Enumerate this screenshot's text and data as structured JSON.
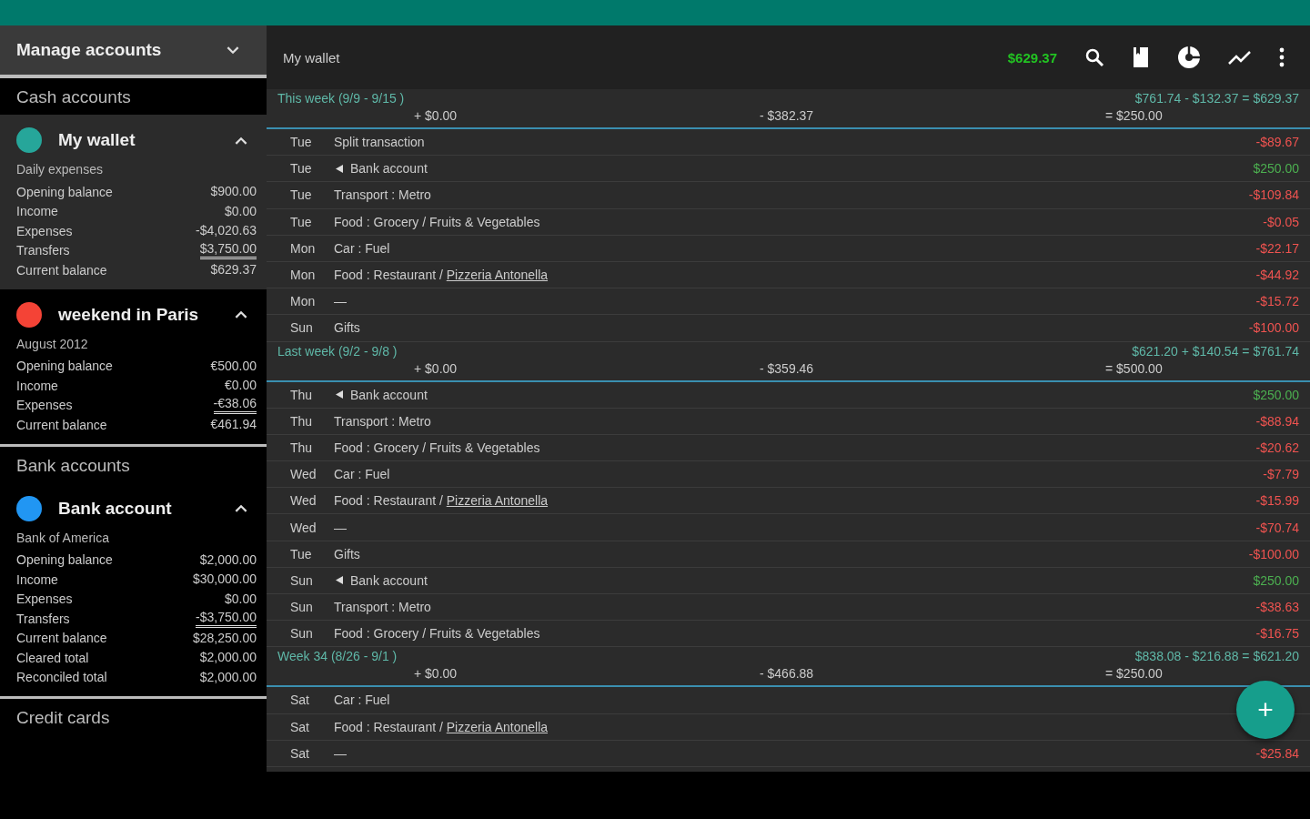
{
  "sidebar": {
    "title": "Manage accounts",
    "groups": [
      {
        "label": "Cash accounts",
        "accounts": [
          {
            "name": "My wallet",
            "color": "#26a69a",
            "expanded": true,
            "selected": true,
            "description": "Daily expenses",
            "lines": [
              {
                "label": "Opening balance",
                "value": "$900.00",
                "rule": false
              },
              {
                "label": "Income",
                "value": "$0.00",
                "rule": false
              },
              {
                "label": "Expenses",
                "value": "-$4,020.63",
                "rule": false
              },
              {
                "label": "Transfers",
                "value": "$3,750.00",
                "rule": true
              },
              {
                "label": "Current balance",
                "value": "$629.37",
                "rule": false
              }
            ]
          },
          {
            "name": "weekend in Paris",
            "color": "#f44336",
            "expanded": true,
            "selected": false,
            "description": "August 2012",
            "lines": [
              {
                "label": "Opening balance",
                "value": "€500.00",
                "rule": false
              },
              {
                "label": "Income",
                "value": "€0.00",
                "rule": false
              },
              {
                "label": "Expenses",
                "value": "-€38.06",
                "rule": true
              },
              {
                "label": "Current balance",
                "value": "€461.94",
                "rule": false
              }
            ]
          }
        ]
      },
      {
        "label": "Bank accounts",
        "accounts": [
          {
            "name": "Bank account",
            "color": "#2196f3",
            "expanded": true,
            "selected": false,
            "description": "Bank of America",
            "lines": [
              {
                "label": "Opening balance",
                "value": "$2,000.00",
                "rule": false
              },
              {
                "label": "Income",
                "value": "$30,000.00",
                "rule": false
              },
              {
                "label": "Expenses",
                "value": "$0.00",
                "rule": false
              },
              {
                "label": "Transfers",
                "value": "-$3,750.00",
                "rule": true
              },
              {
                "label": "Current balance",
                "value": "$28,250.00",
                "rule": false
              },
              {
                "label": "Cleared total",
                "value": "$2,000.00",
                "rule": false
              },
              {
                "label": "Reconciled total",
                "value": "$2,000.00",
                "rule": false
              }
            ]
          }
        ]
      },
      {
        "label": "Credit cards"
      }
    ]
  },
  "toolbar": {
    "title": "My wallet",
    "balance": "$629.37"
  },
  "weeks": [
    {
      "title": "This week (9/9 - 9/15 )",
      "summary": "$761.74 - $132.37 = $629.37",
      "income": "+ $0.00",
      "expense": "- $382.37",
      "transfer": "= $250.00",
      "rows": [
        {
          "day": "Tue",
          "kind": "plain",
          "category": "Split transaction",
          "amount": "-$89.67",
          "color": "#ef5350"
        },
        {
          "day": "Tue",
          "kind": "transfer",
          "category": "Bank account",
          "amount": "$250.00",
          "color": "#4caf50"
        },
        {
          "day": "Tue",
          "kind": "plain",
          "category": "Transport : Metro",
          "amount": "-$109.84",
          "color": "#ef5350"
        },
        {
          "day": "Tue",
          "kind": "plain",
          "category": "Food : Grocery / Fruits & Vegetables",
          "amount": "-$0.05",
          "color": "#ef5350"
        },
        {
          "day": "Mon",
          "kind": "plain",
          "category": "Car : Fuel",
          "amount": "-$22.17",
          "color": "#ef5350"
        },
        {
          "day": "Mon",
          "kind": "plain",
          "category": "Food : Restaurant / ",
          "payee": "Pizzeria Antonella",
          "amount": "-$44.92",
          "color": "#ef5350"
        },
        {
          "day": "Mon",
          "kind": "plain",
          "category": "—",
          "amount": "-$15.72",
          "color": "#ef5350"
        },
        {
          "day": "Sun",
          "kind": "plain",
          "category": "Gifts",
          "amount": "-$100.00",
          "color": "#ef5350"
        }
      ]
    },
    {
      "title": "Last week (9/2 - 9/8 )",
      "summary": "$621.20 + $140.54 = $761.74",
      "income": "+ $0.00",
      "expense": "- $359.46",
      "transfer": "= $500.00",
      "rows": [
        {
          "day": "Thu",
          "kind": "transfer",
          "category": "Bank account",
          "amount": "$250.00",
          "color": "#4caf50"
        },
        {
          "day": "Thu",
          "kind": "plain",
          "category": "Transport : Metro",
          "amount": "-$88.94",
          "color": "#ef5350"
        },
        {
          "day": "Thu",
          "kind": "plain",
          "category": "Food : Grocery / Fruits & Vegetables",
          "amount": "-$20.62",
          "color": "#ef5350"
        },
        {
          "day": "Wed",
          "kind": "plain",
          "category": "Car : Fuel",
          "amount": "-$7.79",
          "color": "#ef5350"
        },
        {
          "day": "Wed",
          "kind": "plain",
          "category": "Food : Restaurant / ",
          "payee": "Pizzeria Antonella",
          "amount": "-$15.99",
          "color": "#ef5350"
        },
        {
          "day": "Wed",
          "kind": "plain",
          "category": "—",
          "amount": "-$70.74",
          "color": "#ef5350"
        },
        {
          "day": "Tue",
          "kind": "plain",
          "category": "Gifts",
          "amount": "-$100.00",
          "color": "#ef5350"
        },
        {
          "day": "Sun",
          "kind": "transfer",
          "category": "Bank account",
          "amount": "$250.00",
          "color": "#4caf50"
        },
        {
          "day": "Sun",
          "kind": "plain",
          "category": "Transport : Metro",
          "amount": "-$38.63",
          "color": "#ef5350"
        },
        {
          "day": "Sun",
          "kind": "plain",
          "category": "Food : Grocery / Fruits & Vegetables",
          "amount": "-$16.75",
          "color": "#ef5350"
        }
      ]
    },
    {
      "title": "Week 34 (8/26 - 9/1 )",
      "summary": "$838.08 - $216.88 = $621.20",
      "income": "+ $0.00",
      "expense": "- $466.88",
      "transfer": "= $250.00",
      "rows": [
        {
          "day": "Sat",
          "kind": "plain",
          "category": "Car : Fuel"
        },
        {
          "day": "Sat",
          "kind": "plain",
          "category": "Food : Restaurant / ",
          "payee": "Pizzeria Antonella"
        },
        {
          "day": "Sat",
          "kind": "plain",
          "category": "—",
          "amount": "-$25.84",
          "color": "#ef5350"
        }
      ]
    }
  ],
  "fab": {
    "label": "+"
  }
}
